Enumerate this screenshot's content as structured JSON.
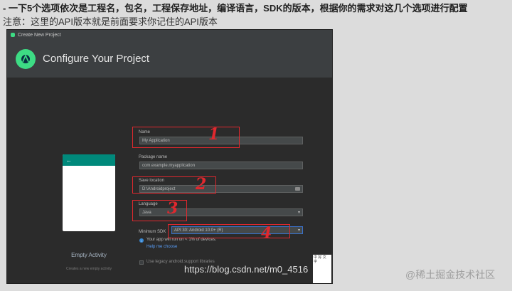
{
  "caption": {
    "line1": "- 一下5个选项依次是工程名，包名，工程保存地址，编译语言，SDK的版本，根据你的需求对这几个选项进行配置",
    "line2": "注意：这里的API版本就是前面要求你记住的API版本"
  },
  "dialog": {
    "window_title": "Create New Project",
    "header_title": "Configure Your Project"
  },
  "template": {
    "name": "Empty Activity",
    "description": "Creates a new empty activity",
    "back_arrow": "←"
  },
  "form": {
    "name_label": "Name",
    "name_value": "My Application",
    "package_label": "Package name",
    "package_value": "com.example.myapplication",
    "save_label": "Save location",
    "save_value": "D:\\Androidproject",
    "language_label": "Language",
    "language_value": "Java",
    "min_sdk_label": "Minimum SDK",
    "min_sdk_value": "API 30: Android 10.0+ (R)",
    "info_text": "Your app will run on < 1% of devices.",
    "help_link": "Help me choose",
    "legacy_label": "Use legacy android.support libraries"
  },
  "annotations": {
    "n1": "1",
    "n2": "2",
    "n3": "3",
    "n4": "4"
  },
  "watermarks": {
    "url": "https://blog.csdn.net/m0_4516",
    "qr_text": "中 好 文 字",
    "juejin": "@稀土掘金技术社区"
  },
  "colors": {
    "accent": "#3ddc84",
    "annotation_red": "#e0282e",
    "link": "#589df6"
  }
}
